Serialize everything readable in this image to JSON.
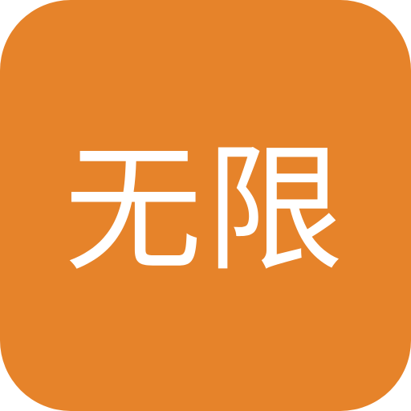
{
  "icon": {
    "label": "无限",
    "background_color": "#E6832A",
    "text_color": "#FFFFFF"
  }
}
